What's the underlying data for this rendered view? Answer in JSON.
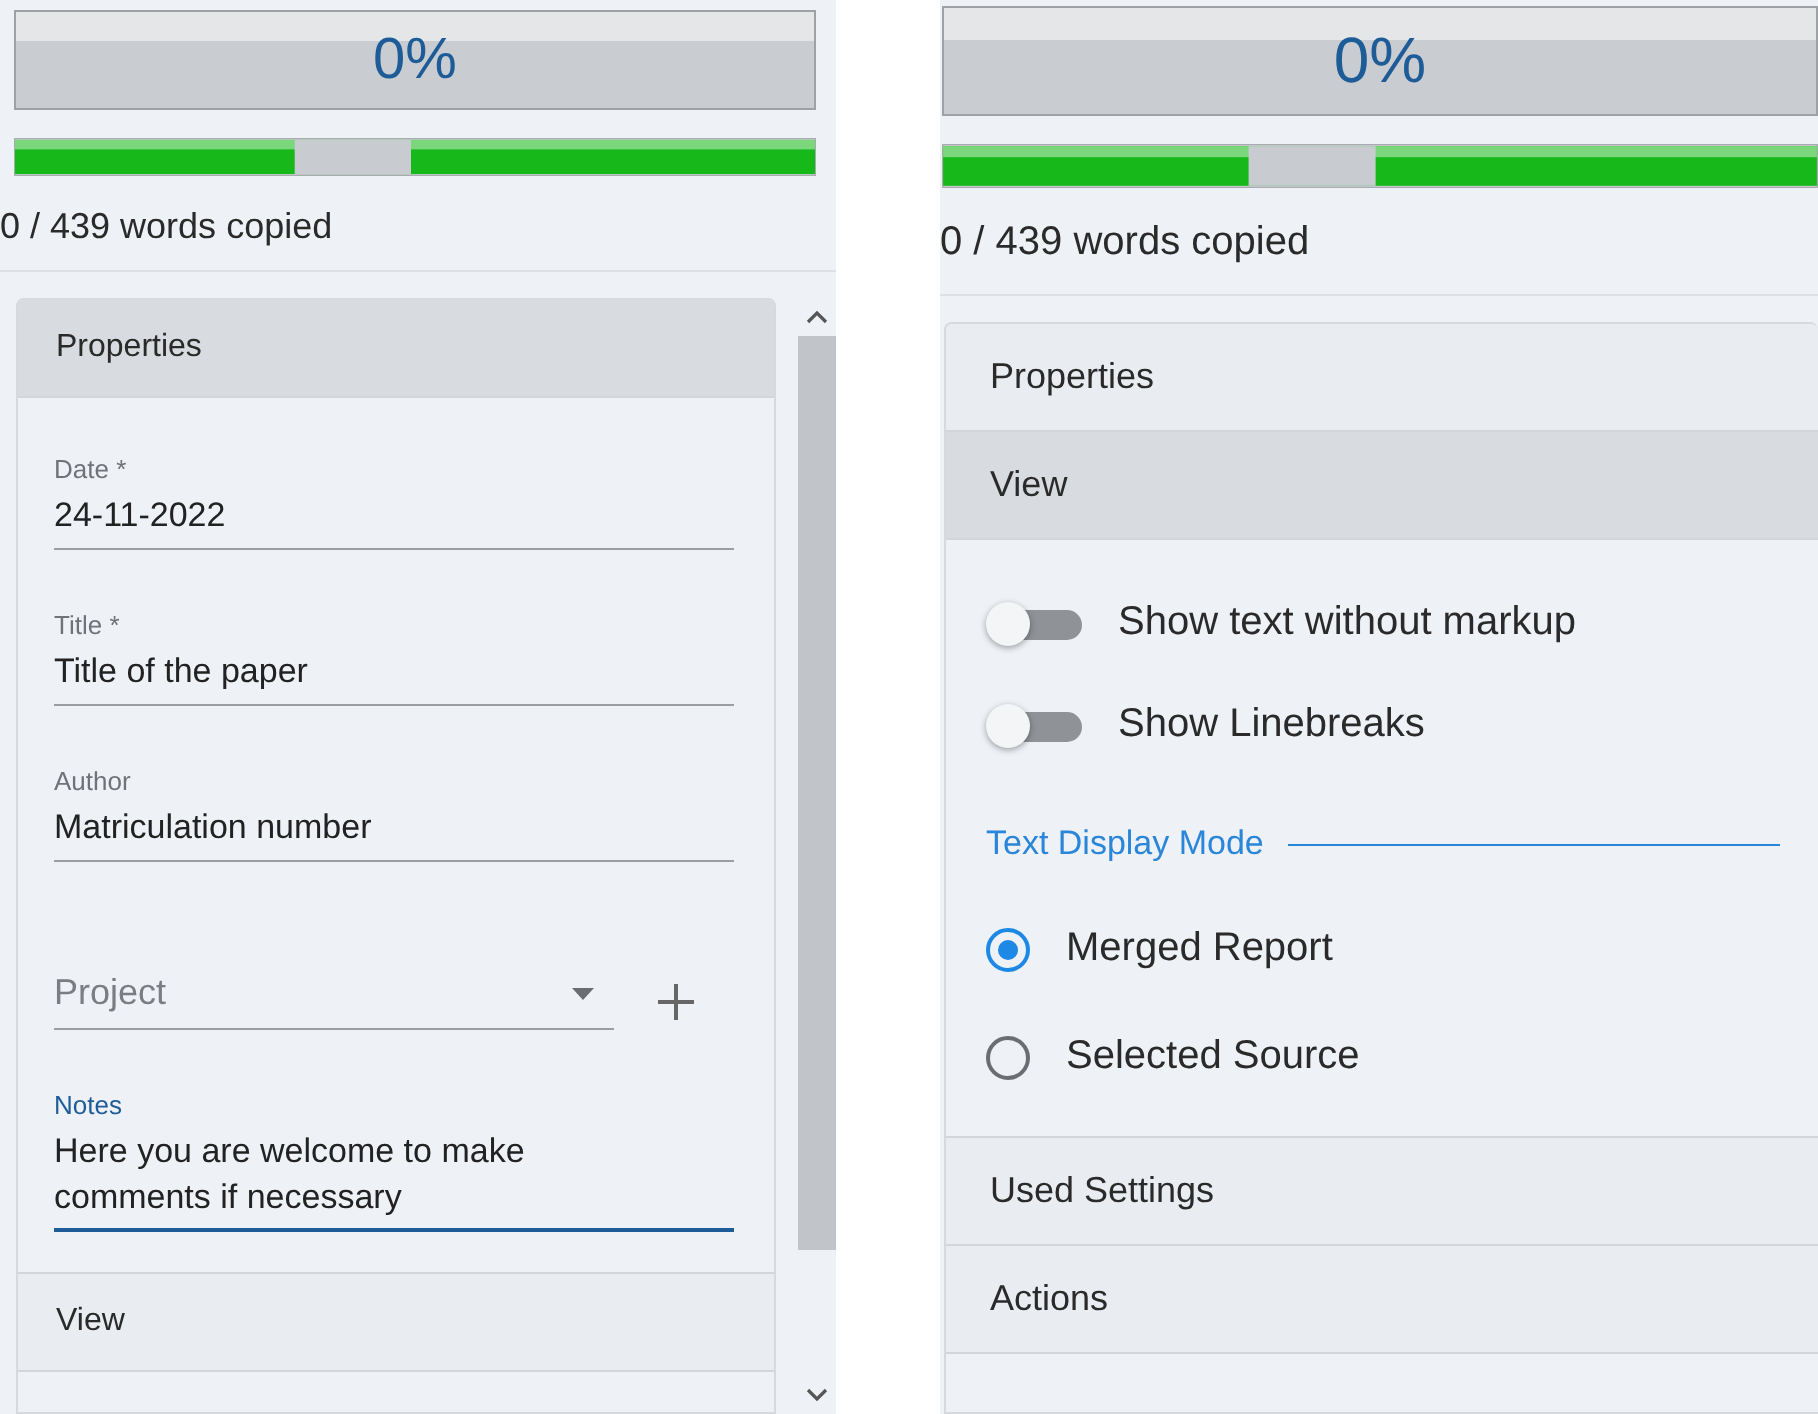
{
  "panels": [
    {
      "kind": "compact",
      "progress_label": "0%",
      "progress": {
        "level": 1
      },
      "words_copied": "0 / 439 words copied",
      "sections": [
        {
          "title": "Properties",
          "expanded": true,
          "items": [
            {
              "kind": "text",
              "label": "Date *",
              "value": "24-11-2022",
              "focused": false
            },
            {
              "kind": "text",
              "label": "Title *",
              "value": "Title of the paper",
              "focused": false
            },
            {
              "kind": "text",
              "label": "Author",
              "value": "Matriculation number",
              "focused": false
            },
            {
              "kind": "select",
              "placeholder": "Project",
              "focused": false
            },
            {
              "kind": "textarea",
              "label": "Notes",
              "value": "Here you are welcome to make comments if necessary",
              "focused": true
            }
          ]
        },
        {
          "title": "View",
          "expanded": false
        }
      ]
    },
    {
      "kind": "large",
      "progress_label": "0%",
      "progress": {
        "level": 1
      },
      "words_copied": "0 / 439 words copied",
      "sections": [
        {
          "title": "Properties",
          "expanded": false
        },
        {
          "title": "View",
          "expanded": true,
          "items": [
            {
              "kind": "toggle",
              "label": "Show text without markup",
              "on": false
            },
            {
              "kind": "toggle",
              "label": "Show Linebreaks",
              "on": false
            },
            {
              "kind": "heading",
              "label": "Text Display Mode"
            },
            {
              "kind": "radio",
              "label": "Merged Report",
              "selected": true
            },
            {
              "kind": "radio",
              "label": "Selected Source",
              "selected": false
            }
          ]
        },
        {
          "title": "Used Settings",
          "expanded": false
        },
        {
          "title": "Actions",
          "expanded": false
        }
      ]
    }
  ]
}
